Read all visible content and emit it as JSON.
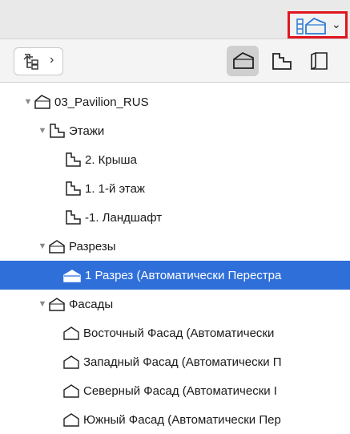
{
  "window": {
    "view_switch": {
      "icon": "view-map-icon",
      "dropdown_icon": "chevron-down-icon"
    }
  },
  "toolbar": {
    "navigator_button": {
      "icon": "project-tree-icon",
      "chevron": "›"
    },
    "modes": [
      {
        "name": "project-map",
        "icon": "project-map-icon",
        "active": true
      },
      {
        "name": "view-map",
        "icon": "view-map-mode-icon",
        "active": false
      },
      {
        "name": "layout-book",
        "icon": "layout-book-icon",
        "active": false
      }
    ]
  },
  "tree": {
    "project": {
      "label": "03_Pavilion_RUS",
      "expanded": true
    },
    "stories": {
      "label": "Этажи",
      "expanded": true,
      "items": [
        {
          "label": "2. Крыша"
        },
        {
          "label": "1. 1-й этаж"
        },
        {
          "label": "-1. Ландшафт"
        }
      ]
    },
    "sections": {
      "label": "Разрезы",
      "expanded": true,
      "items": [
        {
          "label": "1 Разрез (Автоматически Перестра",
          "selected": true
        }
      ]
    },
    "elevations": {
      "label": "Фасады",
      "expanded": true,
      "items": [
        {
          "label": "Восточный Фасад (Автоматически"
        },
        {
          "label": "Западный Фасад (Автоматически П"
        },
        {
          "label": "Северный Фасад (Автоматически I"
        },
        {
          "label": "Южный Фасад (Автоматически Пер"
        }
      ]
    }
  },
  "colors": {
    "selection": "#2f6fd9",
    "highlight_border": "#e0161e",
    "toolbar_bg": "#f4f4f4",
    "topbar_bg": "#e9e9e9"
  }
}
